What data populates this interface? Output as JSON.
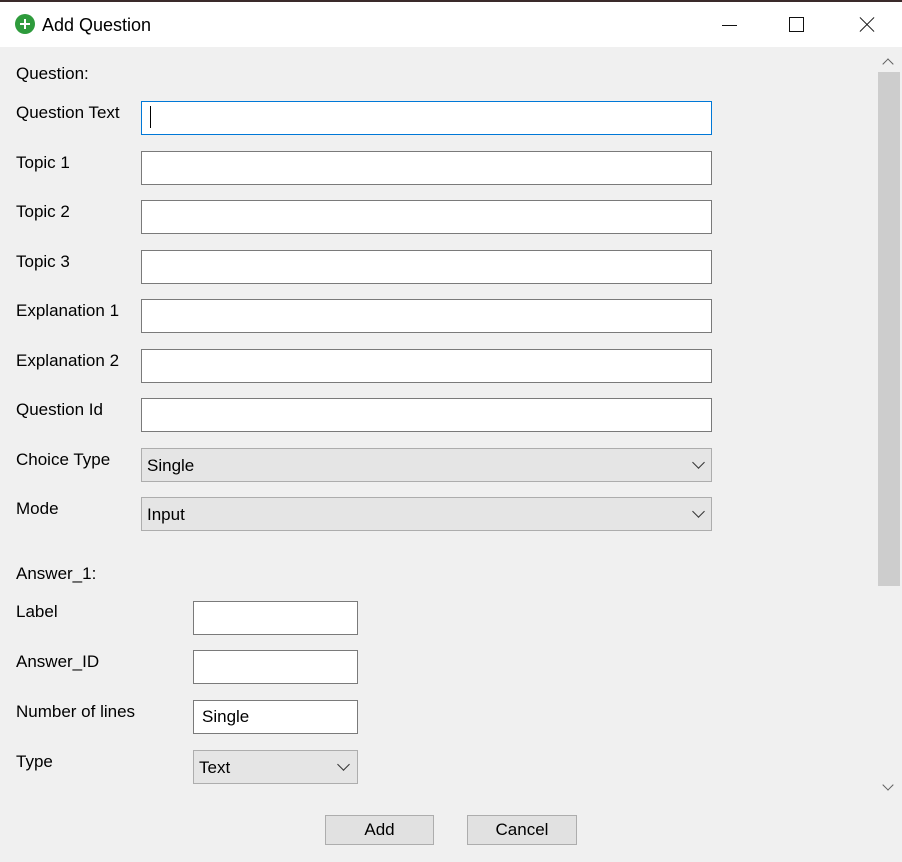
{
  "window": {
    "title": "Add Question"
  },
  "question": {
    "section_label": "Question:",
    "question_text_label": "Question Text",
    "question_text_value": "",
    "topic1_label": "Topic 1",
    "topic1_value": "",
    "topic2_label": "Topic 2",
    "topic2_value": "",
    "topic3_label": "Topic 3",
    "topic3_value": "",
    "explanation1_label": "Explanation 1",
    "explanation1_value": "",
    "explanation2_label": "Explanation 2",
    "explanation2_value": "",
    "question_id_label": "Question Id",
    "question_id_value": "",
    "choice_type_label": "Choice Type",
    "choice_type_value": "Single",
    "mode_label": "Mode",
    "mode_value": "Input"
  },
  "answer": {
    "section_label": "Answer_1:",
    "label_label": "Label",
    "label_value": "",
    "answer_id_label": "Answer_ID",
    "answer_id_value": "",
    "lines_label": "Number of lines",
    "lines_value": "Single",
    "type_label": "Type",
    "type_value": "Text"
  },
  "buttons": {
    "add": "Add",
    "cancel": "Cancel"
  },
  "colors": {
    "icon": "#2e9b3c",
    "focus_border": "#0078d7"
  }
}
